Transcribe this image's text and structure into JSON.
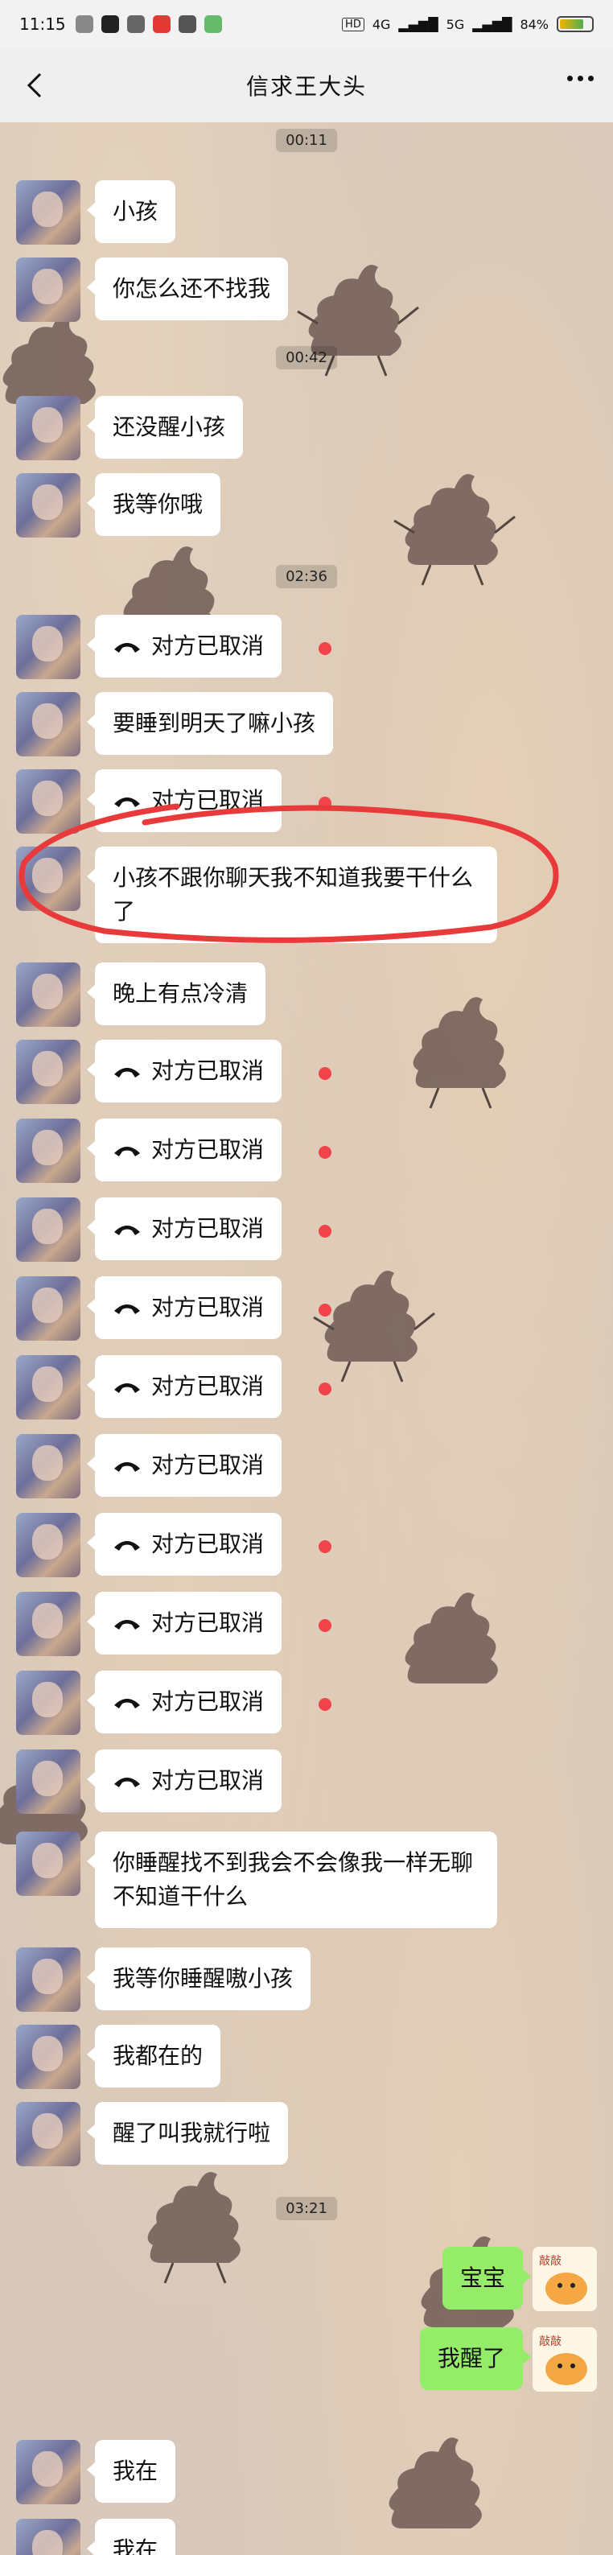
{
  "status": {
    "time": "11:15",
    "network": "4G",
    "network2": "5G",
    "battery": "84%"
  },
  "header": {
    "title": "信求王大头"
  },
  "timestamps": [
    "00:11",
    "00:42",
    "02:36",
    "03:21"
  ],
  "messages": [
    {
      "from": "them",
      "text": "小孩"
    },
    {
      "from": "them",
      "text": "你怎么还不找我"
    },
    {
      "from": "them",
      "text": "还没醒小孩"
    },
    {
      "from": "them",
      "text": "我等你哦"
    },
    {
      "from": "them",
      "text": "对方已取消",
      "recall": true
    },
    {
      "from": "them",
      "text": "要睡到明天了嘛小孩"
    },
    {
      "from": "them",
      "text": "对方已取消",
      "recall": true
    },
    {
      "from": "them",
      "text": "小孩不跟你聊天我不知道我要干什么了"
    },
    {
      "from": "them",
      "text": "晚上有点冷清"
    },
    {
      "from": "them",
      "text": "对方已取消",
      "recall": true
    },
    {
      "from": "them",
      "text": "对方已取消",
      "recall": true
    },
    {
      "from": "them",
      "text": "对方已取消",
      "recall": true
    },
    {
      "from": "them",
      "text": "对方已取消",
      "recall": true
    },
    {
      "from": "them",
      "text": "对方已取消",
      "recall": true
    },
    {
      "from": "them",
      "text": "对方已取消",
      "recall": true
    },
    {
      "from": "them",
      "text": "对方已取消",
      "recall": true
    },
    {
      "from": "them",
      "text": "对方已取消",
      "recall": true
    },
    {
      "from": "them",
      "text": "对方已取消",
      "recall": true
    },
    {
      "from": "them",
      "text": "对方已取消",
      "recall": true
    },
    {
      "from": "them",
      "text": "你睡醒找不到我会不会像我一样无聊不知道干什么"
    },
    {
      "from": "them",
      "text": "我等你睡醒嗷小孩"
    },
    {
      "from": "them",
      "text": "我都在的"
    },
    {
      "from": "them",
      "text": "醒了叫我就行啦"
    },
    {
      "from": "me",
      "text": "宝宝"
    },
    {
      "from": "me",
      "text": "我醒了"
    },
    {
      "from": "them",
      "text": "我在"
    },
    {
      "from": "them",
      "text": "我在"
    }
  ],
  "sticker_text": "敲敲"
}
